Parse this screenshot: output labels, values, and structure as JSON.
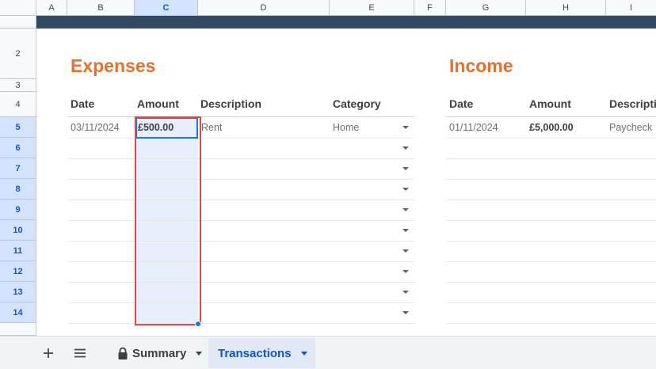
{
  "columns": [
    "A",
    "B",
    "C",
    "D",
    "E",
    "F",
    "G",
    "H",
    "I"
  ],
  "rows": [
    "2",
    "3",
    "4",
    "5",
    "6",
    "7",
    "8",
    "9",
    "10",
    "11",
    "12",
    "13",
    "14"
  ],
  "expenses": {
    "title": "Expenses",
    "headers": {
      "date": "Date",
      "amount": "Amount",
      "description": "Description",
      "category": "Category"
    },
    "row": {
      "date": "03/11/2024",
      "amount": "£500.00",
      "description": "Rent",
      "category": "Home"
    }
  },
  "income": {
    "title": "Income",
    "headers": {
      "date": "Date",
      "amount": "Amount",
      "description": "Descripti"
    },
    "row": {
      "date": "01/11/2024",
      "amount": "£5,000.00",
      "description": "Paycheck"
    }
  },
  "sheet_tabs": {
    "add_icon": "plus-icon",
    "list_icon": "menu-icon",
    "tabs": [
      {
        "label": "Summary",
        "icon": "lock-icon",
        "active": false
      },
      {
        "label": "Transactions",
        "active": true
      }
    ]
  },
  "colors": {
    "band": "#2f4a62",
    "title": "#e8702a",
    "selection": "#1a73e8",
    "highlight": "#e8444a"
  }
}
